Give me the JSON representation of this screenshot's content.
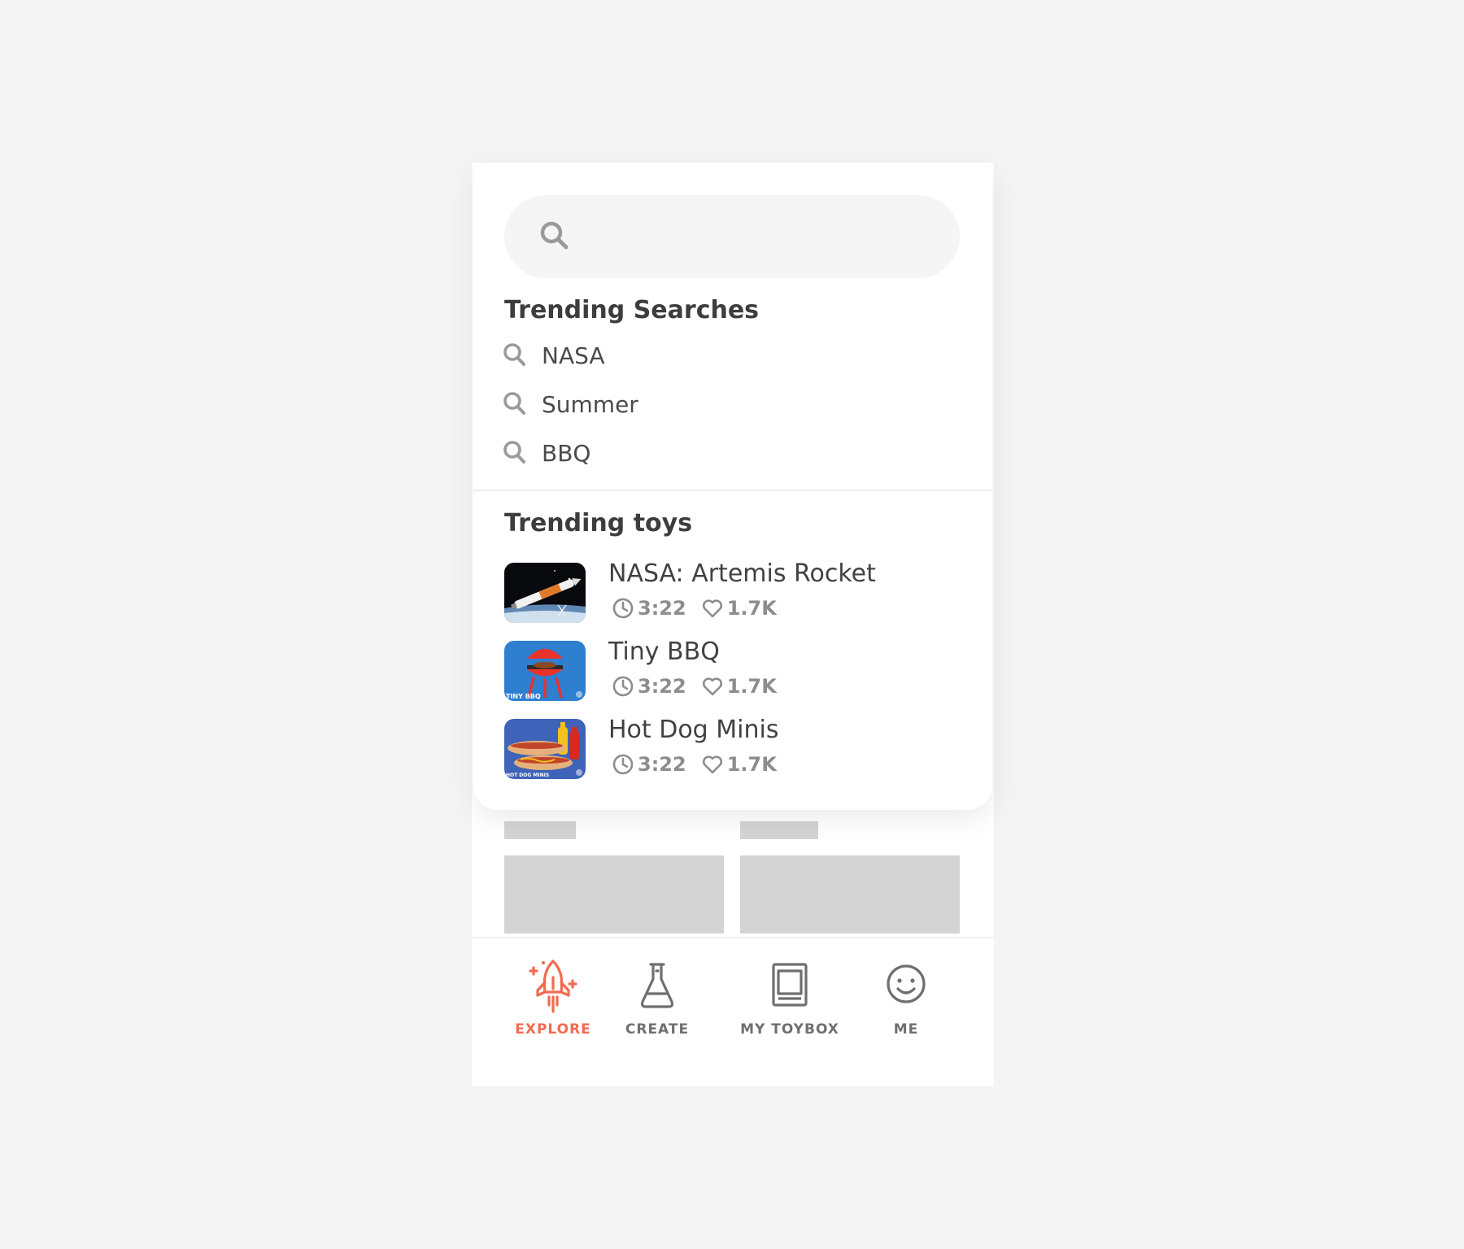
{
  "search": {
    "value": "",
    "placeholder": ""
  },
  "trending_searches": {
    "title": "Trending Searches",
    "items": [
      {
        "label": "NASA"
      },
      {
        "label": "Summer"
      },
      {
        "label": "BBQ"
      }
    ]
  },
  "trending_toys": {
    "title": "Trending toys",
    "items": [
      {
        "name": "NASA: Artemis Rocket",
        "duration": "3:22",
        "likes": "1.7K",
        "thumb_caption": ""
      },
      {
        "name": "Tiny BBQ",
        "duration": "3:22",
        "likes": "1.7K",
        "thumb_caption": "TINY BBQ"
      },
      {
        "name": "Hot Dog Minis",
        "duration": "3:22",
        "likes": "1.7K",
        "thumb_caption": "HOT DOG MINIS"
      }
    ]
  },
  "nav": {
    "items": [
      {
        "label": "EXPLORE",
        "icon": "rocket-icon",
        "active": true
      },
      {
        "label": "CREATE",
        "icon": "flask-icon",
        "active": false
      },
      {
        "label": "MY TOYBOX",
        "icon": "toybox-icon",
        "active": false
      },
      {
        "label": "ME",
        "icon": "smiley-icon",
        "active": false
      }
    ]
  },
  "colors": {
    "accent": "#f26b4f",
    "nav_inactive": "#6f6f6f",
    "meta": "#8d8d8d",
    "heading": "#3d3d3d",
    "skeleton": "#d4d4d4"
  }
}
